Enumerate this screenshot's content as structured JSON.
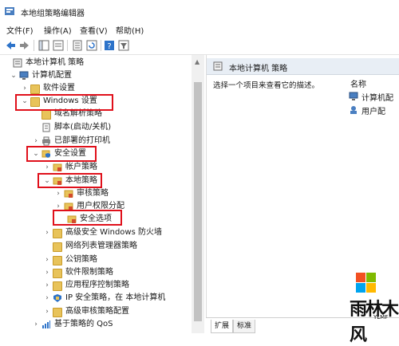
{
  "window": {
    "title": "本地组策略编辑器"
  },
  "menu": {
    "items": [
      "文件(F)",
      "操作(A)",
      "查看(V)",
      "帮助(H)"
    ]
  },
  "tree": {
    "items": [
      {
        "label": "本地计算机 策略",
        "expand": ""
      },
      {
        "label": "计算机配置",
        "expand": "⌄"
      },
      {
        "label": "软件设置",
        "expand": "›"
      },
      {
        "label": "Windows 设置",
        "expand": "⌄"
      },
      {
        "label": "域名解析策略",
        "expand": ""
      },
      {
        "label": "脚本(启动/关机)",
        "expand": ""
      },
      {
        "label": "已部署的打印机",
        "expand": "›"
      },
      {
        "label": "安全设置",
        "expand": "⌄"
      },
      {
        "label": "帐户策略",
        "expand": "›"
      },
      {
        "label": "本地策略",
        "expand": "⌄"
      },
      {
        "label": "审核策略",
        "expand": "›"
      },
      {
        "label": "用户权限分配",
        "expand": "›"
      },
      {
        "label": "安全选项",
        "expand": ""
      },
      {
        "label": "高级安全 Windows 防火墙",
        "expand": "›"
      },
      {
        "label": "网络列表管理器策略",
        "expand": ""
      },
      {
        "label": "公钥策略",
        "expand": "›"
      },
      {
        "label": "软件限制策略",
        "expand": "›"
      },
      {
        "label": "应用程序控制策略",
        "expand": "›"
      },
      {
        "label": "IP 安全策略，在 本地计算机",
        "expand": "›"
      },
      {
        "label": "高级审核策略配置",
        "expand": "›"
      },
      {
        "label": "基于策略的 QoS",
        "expand": "›"
      }
    ]
  },
  "details": {
    "header": "本地计算机 策略",
    "description": "选择一个项目来查看它的描述。",
    "column_name": "名称",
    "items": [
      "计算机配",
      "用户配"
    ]
  },
  "tabs": {
    "items": [
      "扩展",
      "标准"
    ]
  },
  "watermark": {
    "text": "雨林木风",
    "sub": "YLMF"
  },
  "colors": {
    "highlight": "#e0101b",
    "folder": "#e8c35a"
  }
}
